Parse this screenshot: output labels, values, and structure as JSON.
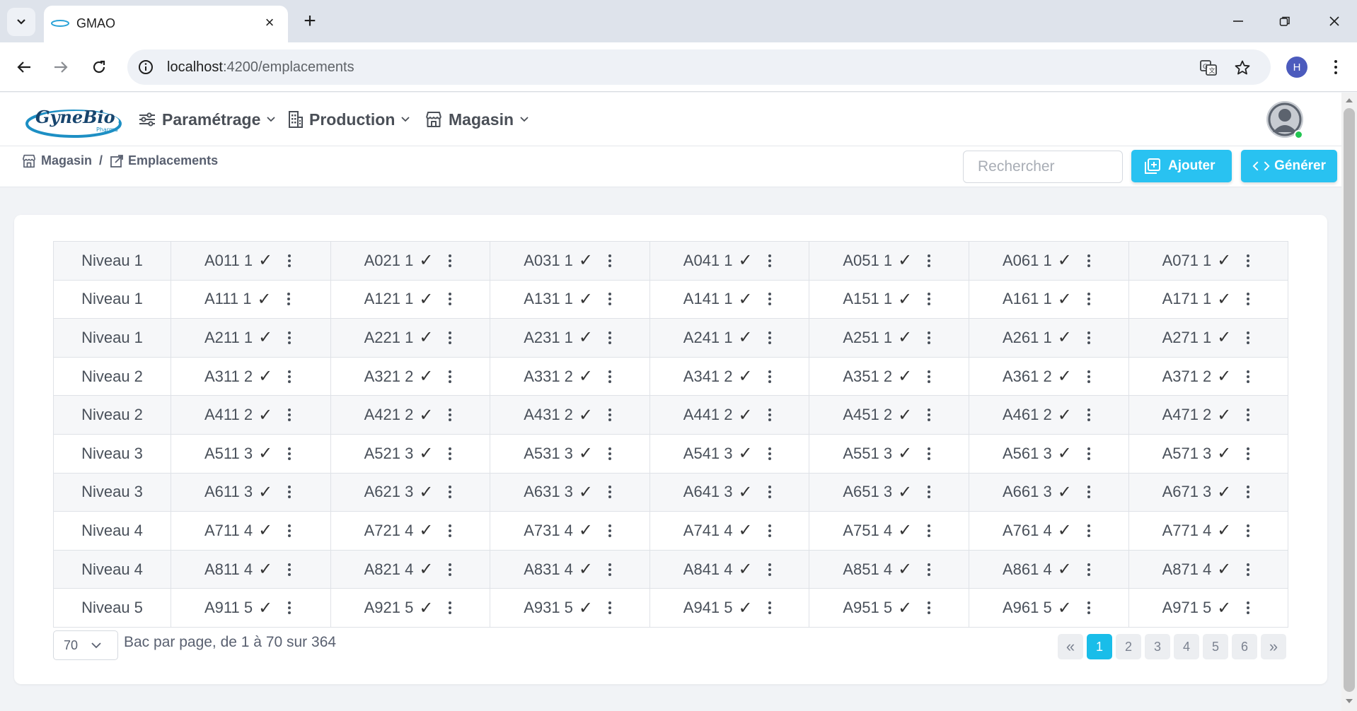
{
  "browser": {
    "tab_title": "GMAO",
    "url_host": "localhost",
    "url_path": ":4200/emplacements",
    "profile_initial": "H"
  },
  "header": {
    "logo_text": "GyneBio",
    "logo_sub": "Pharma",
    "menu": [
      {
        "label": "Paramétrage",
        "icon": "sliders-icon"
      },
      {
        "label": "Production",
        "icon": "building-icon"
      },
      {
        "label": "Magasin",
        "icon": "store-icon"
      }
    ]
  },
  "breadcrumb": {
    "root": "Magasin",
    "separator": "/",
    "current": "Emplacements"
  },
  "toolbar": {
    "search_placeholder": "Rechercher",
    "add_label": "Ajouter",
    "generate_label": "Générer"
  },
  "colors": {
    "accent": "#29c2f1",
    "active_page": "#19bde9",
    "online_status": "#23c552"
  },
  "grid": {
    "rows": [
      {
        "level": "Niveau 1",
        "cells": [
          "A011 1",
          "A021 1",
          "A031 1",
          "A041 1",
          "A051 1",
          "A061 1",
          "A071 1"
        ]
      },
      {
        "level": "Niveau 1",
        "cells": [
          "A111 1",
          "A121 1",
          "A131 1",
          "A141 1",
          "A151 1",
          "A161 1",
          "A171 1"
        ]
      },
      {
        "level": "Niveau 1",
        "cells": [
          "A211 1",
          "A221 1",
          "A231 1",
          "A241 1",
          "A251 1",
          "A261 1",
          "A271 1"
        ]
      },
      {
        "level": "Niveau 2",
        "cells": [
          "A311 2",
          "A321 2",
          "A331 2",
          "A341 2",
          "A351 2",
          "A361 2",
          "A371 2"
        ]
      },
      {
        "level": "Niveau 2",
        "cells": [
          "A411 2",
          "A421 2",
          "A431 2",
          "A441 2",
          "A451 2",
          "A461 2",
          "A471 2"
        ]
      },
      {
        "level": "Niveau 3",
        "cells": [
          "A511 3",
          "A521 3",
          "A531 3",
          "A541 3",
          "A551 3",
          "A561 3",
          "A571 3"
        ]
      },
      {
        "level": "Niveau 3",
        "cells": [
          "A611 3",
          "A621 3",
          "A631 3",
          "A641 3",
          "A651 3",
          "A661 3",
          "A671 3"
        ]
      },
      {
        "level": "Niveau 4",
        "cells": [
          "A711 4",
          "A721 4",
          "A731 4",
          "A741 4",
          "A751 4",
          "A761 4",
          "A771 4"
        ]
      },
      {
        "level": "Niveau 4",
        "cells": [
          "A811 4",
          "A821 4",
          "A831 4",
          "A841 4",
          "A851 4",
          "A861 4",
          "A871 4"
        ]
      },
      {
        "level": "Niveau 5",
        "cells": [
          "A911 5",
          "A921 5",
          "A931 5",
          "A941 5",
          "A951 5",
          "A961 5",
          "A971 5"
        ]
      }
    ],
    "check_glyph": "✓"
  },
  "pagination": {
    "per_page": "70",
    "info": "Bac par page, de 1 à 70 sur 364",
    "first": "«",
    "last": "»",
    "pages": [
      "1",
      "2",
      "3",
      "4",
      "5",
      "6"
    ],
    "current_page": "1"
  }
}
